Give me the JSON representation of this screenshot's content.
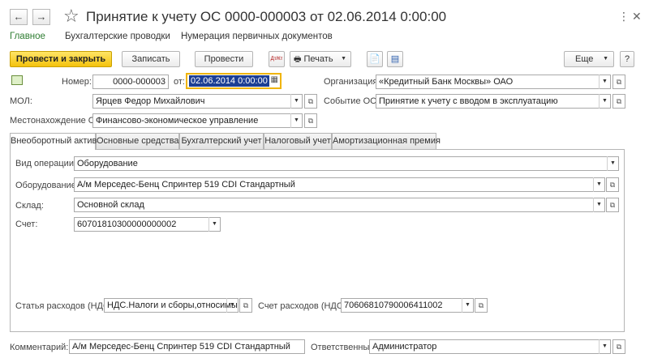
{
  "window": {
    "title": "Принятие к учету ОС 0000-000003 от 02.06.2014 0:00:00",
    "back_glyph": "←",
    "forward_glyph": "→",
    "star_glyph": "☆",
    "more_glyph": "⋮",
    "close_glyph": "✕",
    "icons": [
      "arrow-left-icon",
      "arrow-right-icon",
      "star-icon",
      "more-icon",
      "close-icon"
    ]
  },
  "sections": [
    {
      "label": "Главное",
      "active": true
    },
    {
      "label": "Бухгалтерские проводки",
      "active": false
    },
    {
      "label": "Нумерация первичных документов",
      "active": false
    }
  ],
  "toolbar": {
    "post_close": "Провести и закрыть",
    "save": "Записать",
    "post": "Провести",
    "dtkt_glyph": "Дт/Кт",
    "print": "Печать",
    "print_glyph": "🖶",
    "doc_glyph": "📄",
    "report_glyph": "▤",
    "more": "Еще",
    "help": "?"
  },
  "header_fields": {
    "number_label": "Номер:",
    "number_value": "0000-000003",
    "date_label": "от:",
    "date_value": "02.06.2014  0:00:00",
    "org_label": "Организация:",
    "org_value": "«Кредитный Банк Москвы» ОАО",
    "mol_label": "МОЛ:",
    "mol_value": "Ярцев Федор Михайлович",
    "event_label": "Событие ОС:",
    "event_value": "Принятие к учету с вводом в эксплуатацию",
    "location_label": "Местонахождение ОС:",
    "location_value": "Финансово-экономическое управление"
  },
  "tabs": [
    {
      "label": "Внеоборотный актив",
      "active": true
    },
    {
      "label": "Основные средства",
      "active": false
    },
    {
      "label": "Бухгалтерский учет",
      "active": false
    },
    {
      "label": "Налоговый учет",
      "active": false
    },
    {
      "label": "Амортизационная премия",
      "active": false
    }
  ],
  "asset_tab": {
    "operation_label": "Вид операции:",
    "operation_value": "Оборудование",
    "equipment_label": "Оборудование:",
    "equipment_value": "А/м Мерседес-Бенц Спринтер 519 CDI Стандартный",
    "warehouse_label": "Склад:",
    "warehouse_value": "Основной склад",
    "account_label": "Счет:",
    "account_value": "60701810300000000002",
    "vat_item_label": "Статья расходов (НДС):",
    "vat_item_value": "НДС.Налоги и сборы,относимые н",
    "vat_account_label": "Счет расходов (НДС):",
    "vat_account_value": "70606810790006411002"
  },
  "footer": {
    "comment_label": "Комментарий:",
    "comment_value": "А/м Мерседес-Бенц Спринтер 519 CDI Стандартный",
    "responsible_label": "Ответственный:",
    "responsible_value": "Администратор"
  },
  "colors": {
    "primary_button": "#f4c20d",
    "active_section": "#2e7d32",
    "date_focus": "#f0b400",
    "date_selection": "#1c3f94"
  }
}
